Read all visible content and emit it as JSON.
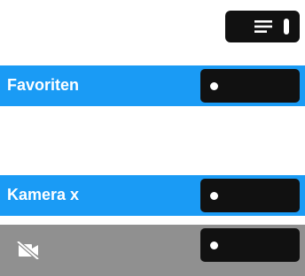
{
  "colors": {
    "highlight": "#1a9bf5",
    "disabled": "#909090",
    "softkey": "#111111",
    "text": "#ffffff"
  },
  "top_button": {
    "icons": [
      "menu-lines-icon",
      "pill-icon"
    ]
  },
  "rows": [
    {
      "label": "Favoriten",
      "state": "highlighted"
    },
    {
      "label": "Kamera x",
      "state": "highlighted"
    },
    {
      "icon": "video-off-icon",
      "state": "disabled"
    }
  ]
}
